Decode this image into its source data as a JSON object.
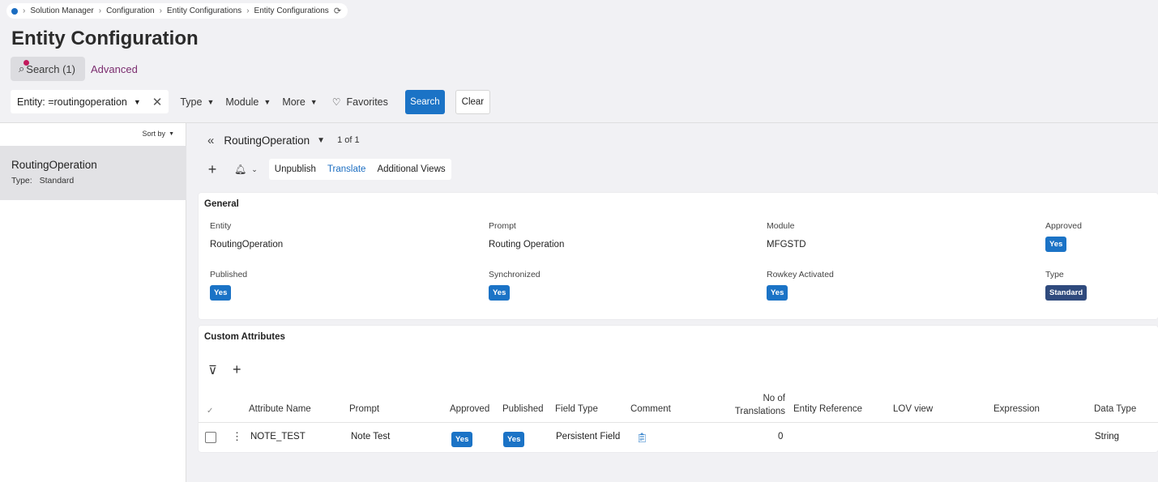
{
  "breadcrumb": {
    "items": [
      "Solution Manager",
      "Configuration",
      "Entity Configurations",
      "Entity Configurations"
    ]
  },
  "page_title": "Entity Configuration",
  "search_tab": {
    "label": "Search (1)"
  },
  "advanced_label": "Advanced",
  "filters": {
    "entity_chip": "Entity: =routingoperation",
    "type": "Type",
    "module": "Module",
    "more": "More",
    "favorites": "Favorites",
    "search_button": "Search",
    "clear_button": "Clear"
  },
  "left_panel": {
    "sort_by": "Sort by",
    "item": {
      "title": "RoutingOperation",
      "type_label": "Type:",
      "type_value": "Standard"
    }
  },
  "record": {
    "name": "RoutingOperation",
    "count": "1 of 1"
  },
  "commands": {
    "unpublish": "Unpublish",
    "translate": "Translate",
    "additional_views": "Additional Views"
  },
  "general": {
    "title": "General",
    "entity_label": "Entity",
    "entity_value": "RoutingOperation",
    "prompt_label": "Prompt",
    "prompt_value": "Routing Operation",
    "module_label": "Module",
    "module_value": "MFGSTD",
    "approved_label": "Approved",
    "approved_value": "Yes",
    "published_label": "Published",
    "published_value": "Yes",
    "synchronized_label": "Synchronized",
    "synchronized_value": "Yes",
    "rowkey_label": "Rowkey Activated",
    "rowkey_value": "Yes",
    "type_label": "Type",
    "type_value": "Standard"
  },
  "custom_attributes": {
    "title": "Custom Attributes",
    "columns": {
      "attribute_name": "Attribute Name",
      "prompt": "Prompt",
      "approved": "Approved",
      "published": "Published",
      "field_type": "Field Type",
      "comment": "Comment",
      "translations_1": "No of",
      "translations_2": "Translations",
      "entity_reference": "Entity Reference",
      "lov_view": "LOV view",
      "expression": "Expression",
      "data_type": "Data Type"
    },
    "rows": [
      {
        "attribute_name": "NOTE_TEST",
        "prompt": "Note Test",
        "approved": "Yes",
        "published": "Yes",
        "field_type": "Persistent Field",
        "translations": "0",
        "data_type": "String"
      }
    ]
  },
  "colors": {
    "primary": "#1b73c6",
    "dark_badge": "#2f4a7d",
    "advanced_link": "#7b2d6f",
    "notification_dot": "#c2185b"
  }
}
